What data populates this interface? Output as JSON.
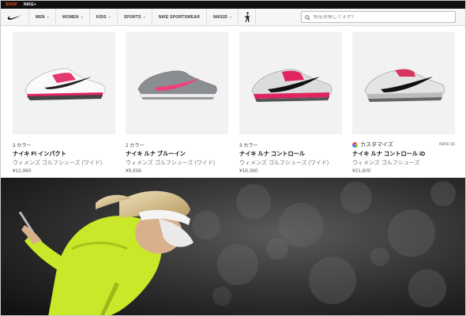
{
  "topbar": {
    "shop": "SHOP",
    "nikeplus": "NIKE+"
  },
  "nav": {
    "items": [
      {
        "label": "MEN",
        "has_dropdown": true
      },
      {
        "label": "WOMEN",
        "has_dropdown": true
      },
      {
        "label": "KIDS",
        "has_dropdown": true
      },
      {
        "label": "SPORTS",
        "has_dropdown": true
      },
      {
        "label": "NIKE SPORTSWEAR",
        "has_dropdown": false
      },
      {
        "label": "NIKEID",
        "has_dropdown": true
      }
    ],
    "search_placeholder": "何をお探しですか?"
  },
  "products": [
    {
      "colors": "3 カラー",
      "title": "ナイキ FI インパクト",
      "subtitle": "ウィメンズ ゴルフシューズ (ワイド)",
      "price": "¥12,960",
      "accent": "#e0245e"
    },
    {
      "colors": "2 カラー",
      "title": "ナイキ ルナ ブルーイン",
      "subtitle": "ウィメンズ ゴルフシューズ (ワイド)",
      "price": "¥9,936",
      "accent": "#f0407a"
    },
    {
      "colors": "3 カラー",
      "title": "ナイキ ルナ コントロール",
      "subtitle": "ウィメンズ ゴルフシューズ (ワイド)",
      "price": "¥18,360",
      "accent": "#e0245e"
    },
    {
      "customize": "カスタマイズ",
      "badge": "NIKE iD",
      "title": "ナイキ ルナ コントロール iD",
      "subtitle": "ウィメンズ ゴルフシューズ",
      "price": "¥21,600",
      "accent": "#d7355d"
    }
  ],
  "hero": {
    "shirt_color": "#c8e829",
    "visor_color": "#f4f4f4"
  }
}
